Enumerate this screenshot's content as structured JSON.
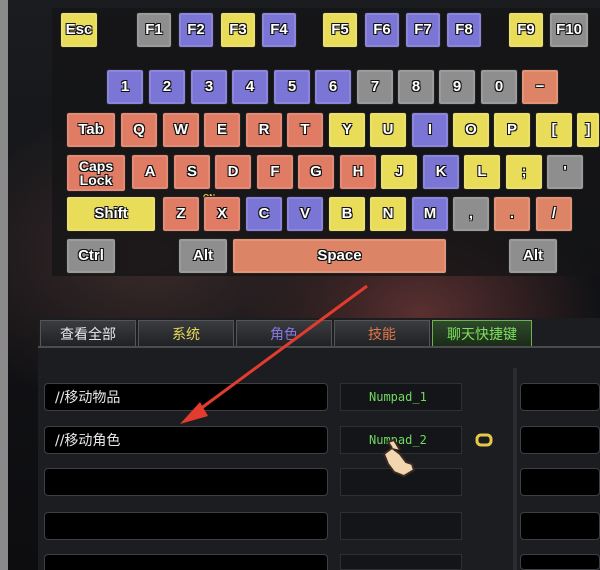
{
  "keyboard": {
    "row_fn": [
      {
        "label": "Esc",
        "color": "yellow"
      },
      {
        "label": "F1",
        "color": "gray"
      },
      {
        "label": "F2",
        "color": "blue"
      },
      {
        "label": "F3",
        "color": "yellow"
      },
      {
        "label": "F4",
        "color": "blue"
      },
      {
        "label": "F5",
        "color": "yellow"
      },
      {
        "label": "F6",
        "color": "blue"
      },
      {
        "label": "F7",
        "color": "blue"
      },
      {
        "label": "F8",
        "color": "blue"
      },
      {
        "label": "F9",
        "color": "yellow"
      },
      {
        "label": "F10",
        "color": "gray"
      }
    ],
    "row_num": [
      "1",
      "2",
      "3",
      "4",
      "5",
      "6",
      "7",
      "8",
      "9",
      "0",
      "−"
    ],
    "row_q": [
      "Tab",
      "Q",
      "W",
      "E",
      "R",
      "T",
      "Y",
      "U",
      "I",
      "O",
      "P",
      "[",
      "]"
    ],
    "row_a": [
      "Caps\nLock",
      "A",
      "S",
      "D",
      "F",
      "G",
      "H",
      "J",
      "K",
      "L",
      ";",
      "'"
    ],
    "row_z": [
      "Shift",
      "Z",
      "X",
      "C",
      "V",
      "B",
      "N",
      "M",
      ",",
      ".",
      "/"
    ],
    "row_space": [
      "Ctrl",
      "Alt",
      "Space",
      "Alt"
    ],
    "on_label": "ON"
  },
  "tabs": [
    {
      "label": "查看全部",
      "color": "#e8e8e8"
    },
    {
      "label": "系统",
      "color": "#e8d85a"
    },
    {
      "label": "角色",
      "color": "#8a78e0"
    },
    {
      "label": "技能",
      "color": "#e07848"
    },
    {
      "label": "聊天快捷键",
      "color": "#7de05c"
    }
  ],
  "bindings": [
    {
      "text": "//移动物品",
      "key": "Numpad_1"
    },
    {
      "text": "//移动角色",
      "key": "Numpad_2"
    },
    {
      "text": "",
      "key": ""
    },
    {
      "text": "",
      "key": ""
    },
    {
      "text": "",
      "key": ""
    }
  ],
  "colors": {
    "accent_arrow": "#e33b2e",
    "key_text": "#6fd860"
  }
}
